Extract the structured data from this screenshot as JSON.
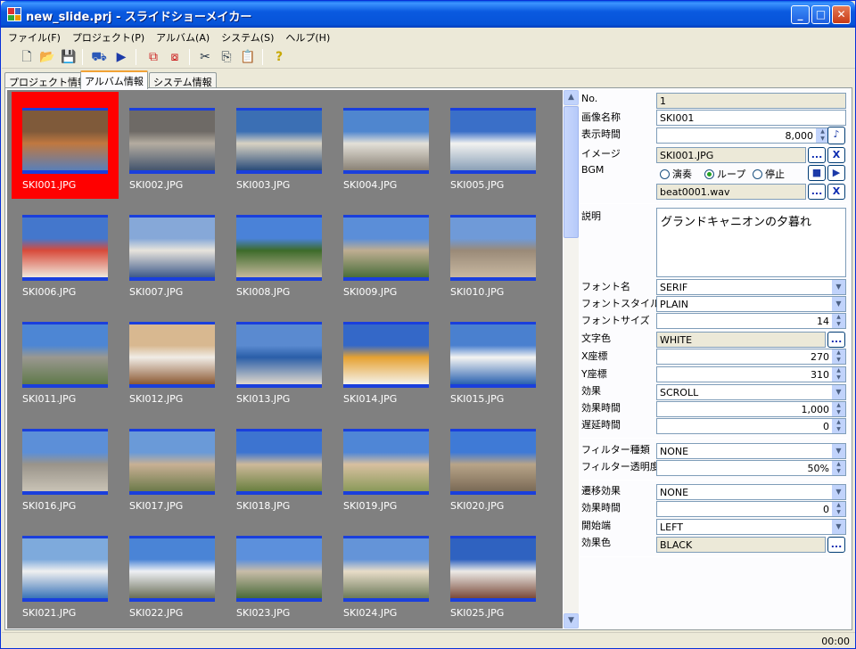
{
  "window": {
    "title": "new_slide.prj - スライドショーメイカー"
  },
  "menu": [
    "ファイル(F)",
    "プロジェクト(P)",
    "アルバム(A)",
    "システム(S)",
    "ヘルプ(H)"
  ],
  "tabs": [
    "プロジェクト情報",
    "アルバム情報",
    "システム情報"
  ],
  "active_tab": "アルバム情報",
  "thumbnails": [
    {
      "name": "SKI001.JPG",
      "colors": [
        "#7f5a3a",
        "#c07840",
        "#5a7fb8"
      ]
    },
    {
      "name": "SKI002.JPG",
      "colors": [
        "#6e6a66",
        "#b4aca0",
        "#44556e"
      ]
    },
    {
      "name": "SKI003.JPG",
      "colors": [
        "#3b6fb4",
        "#d8d2c2",
        "#2a4c7a"
      ]
    },
    {
      "name": "SKI004.JPG",
      "colors": [
        "#4f86cf",
        "#e3e0d8",
        "#8a8276"
      ]
    },
    {
      "name": "SKI005.JPG",
      "colors": [
        "#3a6fc8",
        "#f2f2f0",
        "#8aa0b8"
      ]
    },
    {
      "name": "SKI006.JPG",
      "colors": [
        "#4477cc",
        "#d84a3a",
        "#f0e8dc"
      ]
    },
    {
      "name": "SKI007.JPG",
      "colors": [
        "#86a8d8",
        "#e8e4dc",
        "#3e5a8a"
      ]
    },
    {
      "name": "SKI008.JPG",
      "colors": [
        "#4a82d8",
        "#3d6b2a",
        "#c4b89c"
      ]
    },
    {
      "name": "SKI009.JPG",
      "colors": [
        "#5b8ed8",
        "#bfae92",
        "#4a6e3a"
      ]
    },
    {
      "name": "SKI010.JPG",
      "colors": [
        "#6f9ad8",
        "#9a8a78",
        "#c8b8a0"
      ]
    },
    {
      "name": "SKI011.JPG",
      "colors": [
        "#4d86d4",
        "#9a9890",
        "#5f7a4a"
      ]
    },
    {
      "name": "SKI012.JPG",
      "colors": [
        "#d8b890",
        "#f0ece6",
        "#8c5a34"
      ]
    },
    {
      "name": "SKI013.JPG",
      "colors": [
        "#5a8ad0",
        "#2a5ea8",
        "#e0d8cc"
      ]
    },
    {
      "name": "SKI014.JPG",
      "colors": [
        "#3468c8",
        "#e6a232",
        "#f4f2ea"
      ]
    },
    {
      "name": "SKI015.JPG",
      "colors": [
        "#4a80cf",
        "#f4f4f2",
        "#2a62b0"
      ]
    },
    {
      "name": "SKI016.JPG",
      "colors": [
        "#5c8fd8",
        "#9a948a",
        "#c9c3b6"
      ]
    },
    {
      "name": "SKI017.JPG",
      "colors": [
        "#6a9ad8",
        "#c8b094",
        "#6c7a4a"
      ]
    },
    {
      "name": "SKI018.JPG",
      "colors": [
        "#3d74d0",
        "#cdb99a",
        "#6a8040"
      ]
    },
    {
      "name": "SKI019.JPG",
      "colors": [
        "#4f86d6",
        "#d8c0a0",
        "#8a9a5a"
      ]
    },
    {
      "name": "SKI020.JPG",
      "colors": [
        "#3f7ad6",
        "#b8a488",
        "#7a6a56"
      ]
    },
    {
      "name": "SKI021.JPG",
      "colors": [
        "#7eaadc",
        "#f0f0f0",
        "#3a74b8"
      ]
    },
    {
      "name": "SKI022.JPG",
      "colors": [
        "#4a84d6",
        "#eef0f4",
        "#6a6e58"
      ]
    },
    {
      "name": "SKI023.JPG",
      "colors": [
        "#5c90dc",
        "#c8bca8",
        "#4a6a3a"
      ]
    },
    {
      "name": "SKI024.JPG",
      "colors": [
        "#6494d8",
        "#e8dcc8",
        "#6c7a5a"
      ]
    },
    {
      "name": "SKI025.JPG",
      "colors": [
        "#2f62c0",
        "#eceae6",
        "#7a4a3a"
      ]
    }
  ],
  "selected_thumbnail": "SKI001.JPG",
  "props": {
    "no_label": "No.",
    "no_value": "1",
    "name_label": "画像名称",
    "name_value": "SKI001",
    "time_label": "表示時間",
    "time_value": "8,000",
    "image_label": "イメージ",
    "image_value": "SKI001.JPG",
    "bgm_label": "BGM",
    "bgm_options": [
      "演奏",
      "ループ",
      "停止"
    ],
    "bgm_selected": "ループ",
    "bgm_file": "beat0001.wav",
    "desc_label": "説明",
    "desc_value": "グランドキャニオンの夕暮れ",
    "font_label": "フォント名",
    "font_value": "SERIF",
    "style_label": "フォントスタイル",
    "style_value": "PLAIN",
    "size_label": "フォントサイズ",
    "size_value": "14",
    "color_label": "文字色",
    "color_value": "WHITE",
    "x_label": "X座標",
    "x_value": "270",
    "y_label": "Y座標",
    "y_value": "310",
    "effect_label": "効果",
    "effect_value": "SCROLL",
    "effect_time_label": "効果時間",
    "effect_time_value": "1,000",
    "delay_label": "遅延時間",
    "delay_value": "0",
    "filter_label": "フィルター種類",
    "filter_value": "NONE",
    "filter_alpha_label": "フィルター透明度",
    "filter_alpha_value": "50%",
    "trans_label": "遷移効果",
    "trans_value": "NONE",
    "trans_time_label": "効果時間",
    "trans_time_value": "0",
    "start_label": "開始端",
    "start_value": "LEFT",
    "trans_color_label": "効果色",
    "trans_color_value": "BLACK",
    "browse": "...",
    "clear": "X"
  },
  "status": {
    "time": "00:00"
  }
}
